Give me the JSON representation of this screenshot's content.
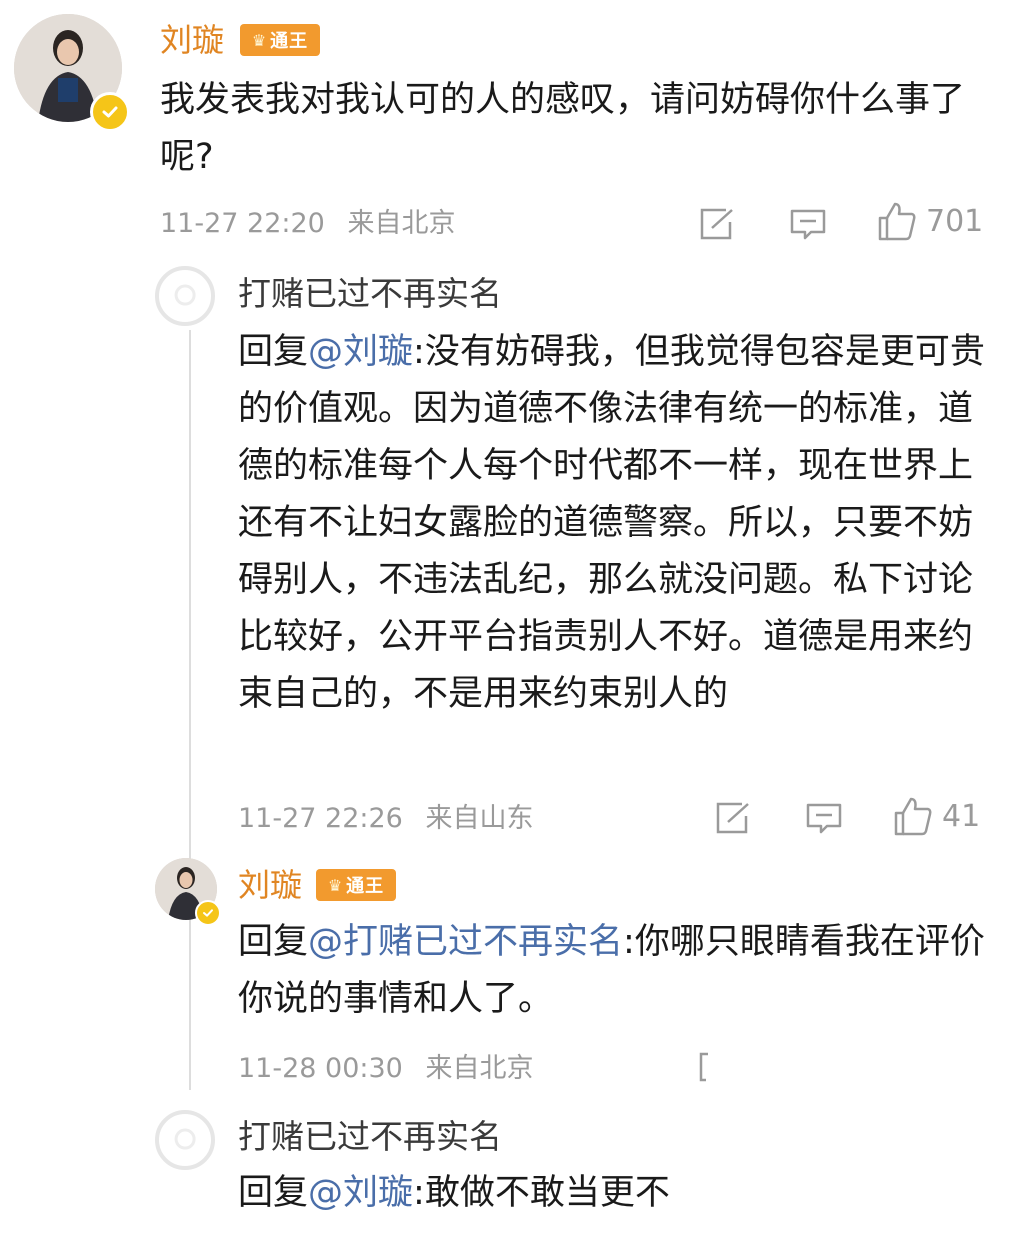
{
  "comments": [
    {
      "user": "刘璇",
      "badge": "通王",
      "text": "我发表我对我认可的人的感叹，请问妨碍你什么事了呢?",
      "time": "11-27 22:20",
      "location": "来自北京",
      "likes": "701"
    },
    {
      "user": "打赌已过不再实名",
      "reply_prefix": "回复",
      "mention": "@刘璇",
      "text": ":没有妨碍我，但我觉得包容是更可贵的价值观。因为道德不像法律有统一的标准，道德的标准每个人每个时代都不一样，现在世界上还有不让妇女露脸的道德警察。所以，只要不妨碍别人，不违法乱纪，那么就没问题。私下讨论比较好，公开平台指责别人不好。道德是用来约束自己的，不是用来约束别人的",
      "time": "11-27 22:26",
      "location": "来自山东",
      "likes": "41"
    },
    {
      "user": "刘璇",
      "badge": "通王",
      "reply_prefix": "回复",
      "mention": "@打赌已过不再实名",
      "text": ":你哪只眼睛看我在评价你说的事情和人了。",
      "time": "11-28 00:30",
      "location": "来自北京"
    },
    {
      "user": "打赌已过不再实名",
      "reply_prefix": "回复",
      "mention": "@刘璇",
      "text": ":敢做不敢当更不"
    }
  ],
  "icons": {
    "repost": "repost-icon",
    "comment": "comment-icon",
    "like": "like-icon",
    "verified": "verified-icon"
  },
  "colors": {
    "name": "#e08522",
    "mention": "#4a6ea9",
    "meta": "#9a9a9a",
    "badge": "#f29a2e",
    "verified": "#f5c518"
  }
}
